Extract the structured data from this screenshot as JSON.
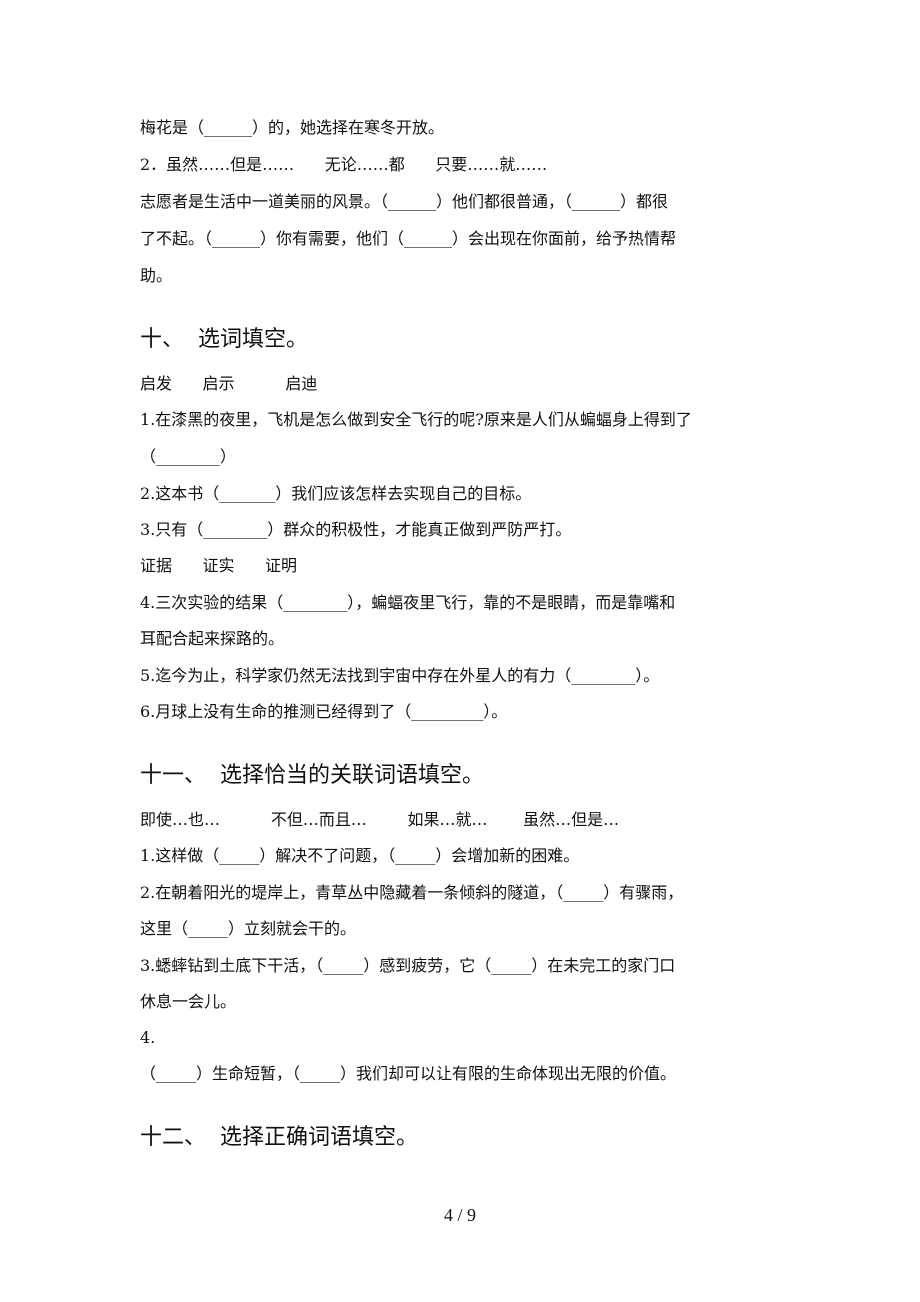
{
  "lines": {
    "l1": "梅花是（______）的，她选择在寒冬开放。",
    "l2": "2．虽然……但是……      无论……都      只要……就……",
    "l3": "志愿者是生活中一道美丽的风景。（______）他们都很普通，（______）都很",
    "l4": "了不起。（______）你有需要，他们（______）会出现在你面前，给予热情帮",
    "l5": "助。"
  },
  "section10": {
    "title": "十、  选词填空。",
    "words1": "启发      启示          启迪",
    "q1a": "1.在漆黑的夜里，飞机是怎么做到安全飞行的呢?原来是人们从蝙蝠身上得到了",
    "q1b": "（________）",
    "q2": "2.这本书（_______）我们应该怎样去实现自己的目标。",
    "q3": "3.只有（________）群众的积极性，才能真正做到严防严打。",
    "words2": "证据      证实      证明",
    "q4a": "4.三次实验的结果（________），蝙蝠夜里飞行，靠的不是眼睛，而是靠嘴和",
    "q4b": "耳配合起来探路的。",
    "q5": "5.迄今为止，科学家仍然无法找到宇宙中存在外星人的有力（________）。",
    "q6": "6.月球上没有生命的推测已经得到了（_________）。"
  },
  "section11": {
    "title": "十一、  选择恰当的关联词语填空。",
    "words": "即使…也…          不但…而且…        如果…就…       虽然…但是…",
    "q1": "1.这样做（_____）解决不了问题，（_____）会增加新的困难。",
    "q2a": "2.在朝着阳光的堤岸上，青草丛中隐藏着一条倾斜的隧道，（_____）有骤雨，",
    "q2b": "这里（_____）立刻就会干的。",
    "q3a": "3.蟋蟀钻到土底下干活，（_____）感到疲劳，它（_____）在未完工的家门口",
    "q3b": "休息一会儿。",
    "q4a": "4.",
    "q4b": "（_____）生命短暂，（_____）我们却可以让有限的生命体现出无限的价值。"
  },
  "section12": {
    "title": "十二、  选择正确词语填空。"
  },
  "footer": {
    "page": "4 / 9"
  }
}
